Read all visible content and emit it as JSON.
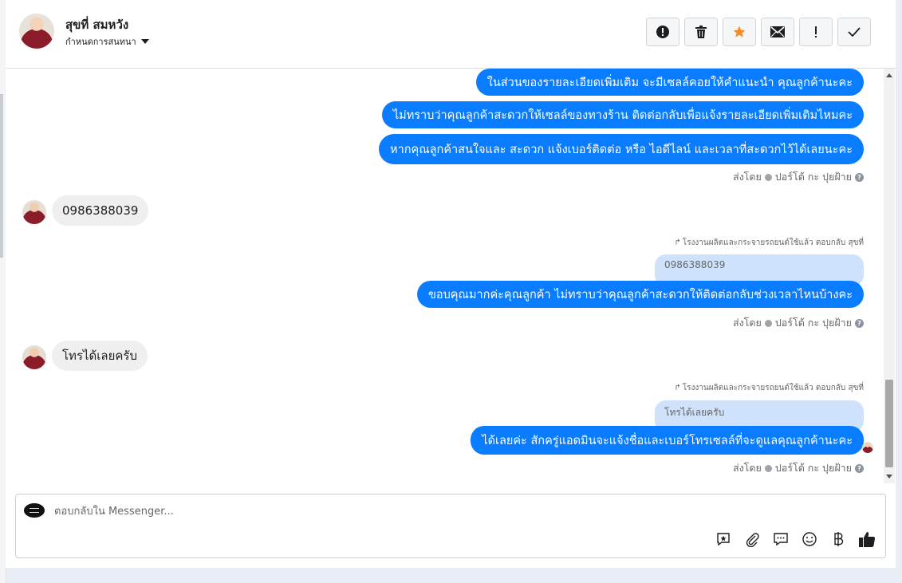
{
  "contact": {
    "name": "สุขที่ สมหวัง",
    "subtitle": "กำหนดการสนทนา"
  },
  "toolbar": {
    "buttons": [
      {
        "name": "alert-icon",
        "title": "spam"
      },
      {
        "name": "trash-icon",
        "title": "delete"
      },
      {
        "name": "star-icon",
        "title": "star"
      },
      {
        "name": "mail-icon",
        "title": "mark unread"
      },
      {
        "name": "exclamation-icon",
        "title": "follow up"
      },
      {
        "name": "check-icon",
        "title": "done"
      }
    ],
    "star_color": "#f28c28"
  },
  "messages": {
    "out1": "ในส่วนของรายละเอียดเพิ่มเติม จะมีเซลล์คอยให้คำแนะนำ คุณลูกค้านะคะ",
    "out2": "ไม่ทราบว่าคุณลูกค้าสะดวกให้เซลล์ของทางร้าน ติดต่อกลับเพื่อแจ้งรายละเอียดเพิ่มเติมไหมคะ",
    "out3": "หากคุณลูกค้าสนใจและ สะดวก แจ้งเบอร์ติดต่อ หรือ ไอดีไลน์ และเวลาที่สะดวกไว้ได้เลยนะคะ",
    "sent_by_1": "ส่งโดย",
    "sender_1": "ปอร์โต้ กะ ปุยฝ้าย",
    "in1": "0986388039",
    "reply_to_1": "โรงงานผลิตและกระจายรถยนต์ใช้แล้ว ตอบกลับ สุขที่",
    "quote_1": "0986388039",
    "out4": "ขอบคุณมากค่ะคุณลูกค้า ไม่ทราบว่าคุณลูกค้าสะดวกให้ติดต่อกลับช่วงเวลาไหนบ้างคะ",
    "sent_by_2": "ส่งโดย",
    "sender_2": "ปอร์โต้ กะ ปุยฝ้าย",
    "in2": "โทรได้เลยครับ",
    "reply_to_2": "โรงงานผลิตและกระจายรถยนต์ใช้แล้ว ตอบกลับ สุขที่",
    "quote_2": "โทรได้เลยครับ",
    "out5": "ได้เลยค่ะ สักครู่แอดมินจะแจ้งชื่อและเบอร์โทรเซลล์ที่จะดูแลคุณลูกค้านะคะ",
    "sent_by_3": "ส่งโดย",
    "sender_3": "ปอร์โต้ กะ ปุยฝ้าย"
  },
  "composer": {
    "placeholder": "ตอบกลับใน Messenger...",
    "tools": [
      "saved-reply-icon",
      "attachment-icon",
      "chat-icon",
      "emoji-icon",
      "baht-icon",
      "like-icon"
    ]
  },
  "colors": {
    "outgoing_bubble": "#0a7cff",
    "incoming_bubble": "#efefef",
    "quote_bubble": "#cfe2fb"
  }
}
